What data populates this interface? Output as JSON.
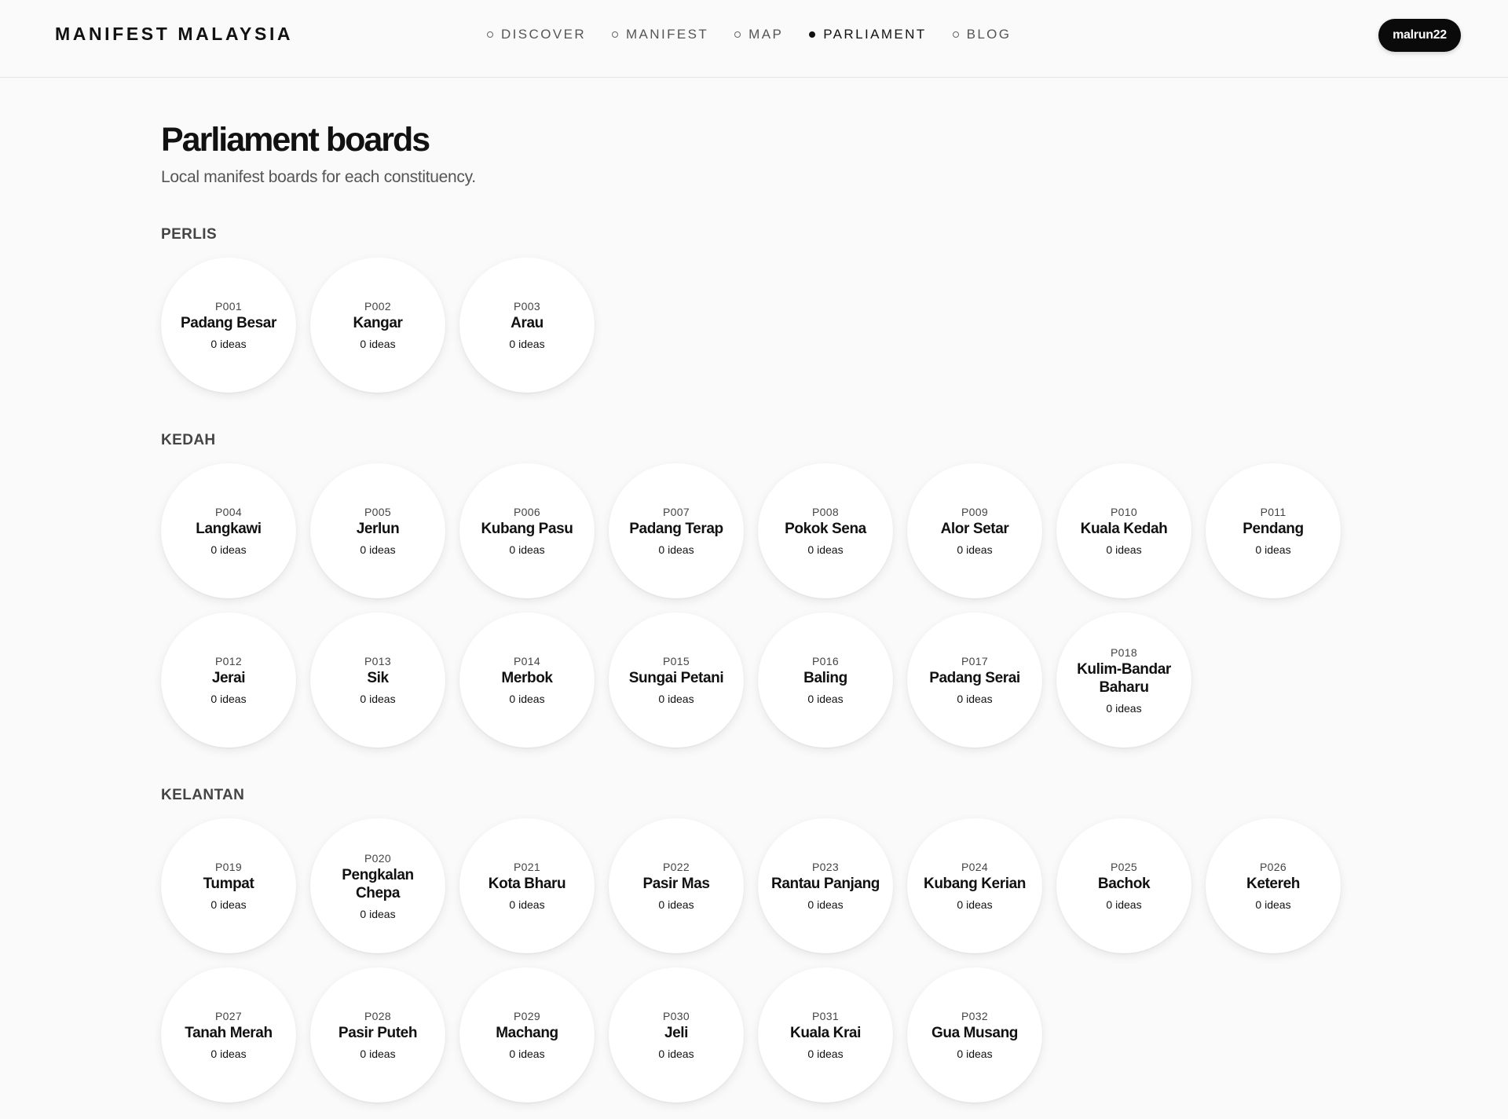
{
  "brand": "MANIFEST MALAYSIA",
  "nav": [
    {
      "label": "DISCOVER",
      "active": false
    },
    {
      "label": "MANIFEST",
      "active": false
    },
    {
      "label": "MAP",
      "active": false
    },
    {
      "label": "PARLIAMENT",
      "active": true
    },
    {
      "label": "BLOG",
      "active": false
    }
  ],
  "user": {
    "name": "malrun22"
  },
  "page": {
    "title": "Parliament boards",
    "subtitle": "Local manifest boards for each constituency."
  },
  "states": [
    {
      "name": "PERLIS",
      "boards": [
        {
          "code": "P001",
          "name": "Padang Besar",
          "count": "0 ideas"
        },
        {
          "code": "P002",
          "name": "Kangar",
          "count": "0 ideas"
        },
        {
          "code": "P003",
          "name": "Arau",
          "count": "0 ideas"
        }
      ]
    },
    {
      "name": "KEDAH",
      "boards": [
        {
          "code": "P004",
          "name": "Langkawi",
          "count": "0 ideas"
        },
        {
          "code": "P005",
          "name": "Jerlun",
          "count": "0 ideas"
        },
        {
          "code": "P006",
          "name": "Kubang Pasu",
          "count": "0 ideas"
        },
        {
          "code": "P007",
          "name": "Padang Terap",
          "count": "0 ideas"
        },
        {
          "code": "P008",
          "name": "Pokok Sena",
          "count": "0 ideas"
        },
        {
          "code": "P009",
          "name": "Alor Setar",
          "count": "0 ideas"
        },
        {
          "code": "P010",
          "name": "Kuala Kedah",
          "count": "0 ideas"
        },
        {
          "code": "P011",
          "name": "Pendang",
          "count": "0 ideas"
        },
        {
          "code": "P012",
          "name": "Jerai",
          "count": "0 ideas"
        },
        {
          "code": "P013",
          "name": "Sik",
          "count": "0 ideas"
        },
        {
          "code": "P014",
          "name": "Merbok",
          "count": "0 ideas"
        },
        {
          "code": "P015",
          "name": "Sungai Petani",
          "count": "0 ideas"
        },
        {
          "code": "P016",
          "name": "Baling",
          "count": "0 ideas"
        },
        {
          "code": "P017",
          "name": "Padang Serai",
          "count": "0 ideas"
        },
        {
          "code": "P018",
          "name": "Kulim-Bandar Baharu",
          "count": "0 ideas"
        }
      ]
    },
    {
      "name": "KELANTAN",
      "boards": [
        {
          "code": "P019",
          "name": "Tumpat",
          "count": "0 ideas"
        },
        {
          "code": "P020",
          "name": "Pengkalan Chepa",
          "count": "0 ideas"
        },
        {
          "code": "P021",
          "name": "Kota Bharu",
          "count": "0 ideas"
        },
        {
          "code": "P022",
          "name": "Pasir Mas",
          "count": "0 ideas"
        },
        {
          "code": "P023",
          "name": "Rantau Panjang",
          "count": "0 ideas"
        },
        {
          "code": "P024",
          "name": "Kubang Kerian",
          "count": "0 ideas"
        },
        {
          "code": "P025",
          "name": "Bachok",
          "count": "0 ideas"
        },
        {
          "code": "P026",
          "name": "Ketereh",
          "count": "0 ideas"
        },
        {
          "code": "P027",
          "name": "Tanah Merah",
          "count": "0 ideas"
        },
        {
          "code": "P028",
          "name": "Pasir Puteh",
          "count": "0 ideas"
        },
        {
          "code": "P029",
          "name": "Machang",
          "count": "0 ideas"
        },
        {
          "code": "P030",
          "name": "Jeli",
          "count": "0 ideas"
        },
        {
          "code": "P031",
          "name": "Kuala Krai",
          "count": "0 ideas"
        },
        {
          "code": "P032",
          "name": "Gua Musang",
          "count": "0 ideas"
        }
      ]
    }
  ]
}
